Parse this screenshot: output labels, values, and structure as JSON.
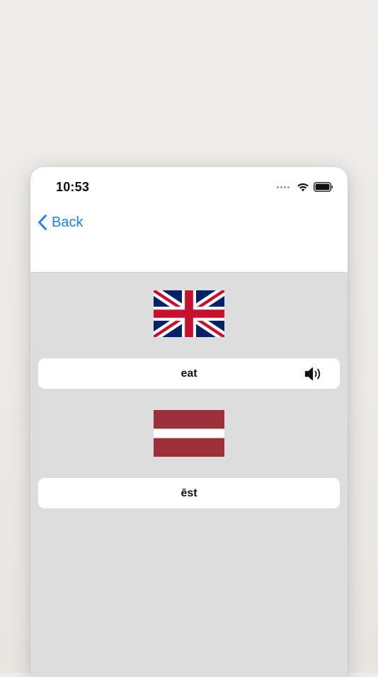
{
  "status_bar": {
    "time": "10:53",
    "icons": [
      "cellular-dots-icon",
      "wifi-icon",
      "battery-icon"
    ]
  },
  "nav": {
    "back_label": "Back",
    "back_icon": "chevron-left-icon"
  },
  "source": {
    "flag": "united-kingdom-flag",
    "word": "eat",
    "audio_icon": "speaker-icon"
  },
  "target": {
    "flag": "latvia-flag",
    "word": "ēst"
  },
  "colors": {
    "accent": "#1a82f4",
    "content_background": "#dddddd",
    "card_background": "#ffffff",
    "uk_blue": "#012169",
    "uk_red": "#C8102E",
    "latvia_red": "#9E3039"
  }
}
